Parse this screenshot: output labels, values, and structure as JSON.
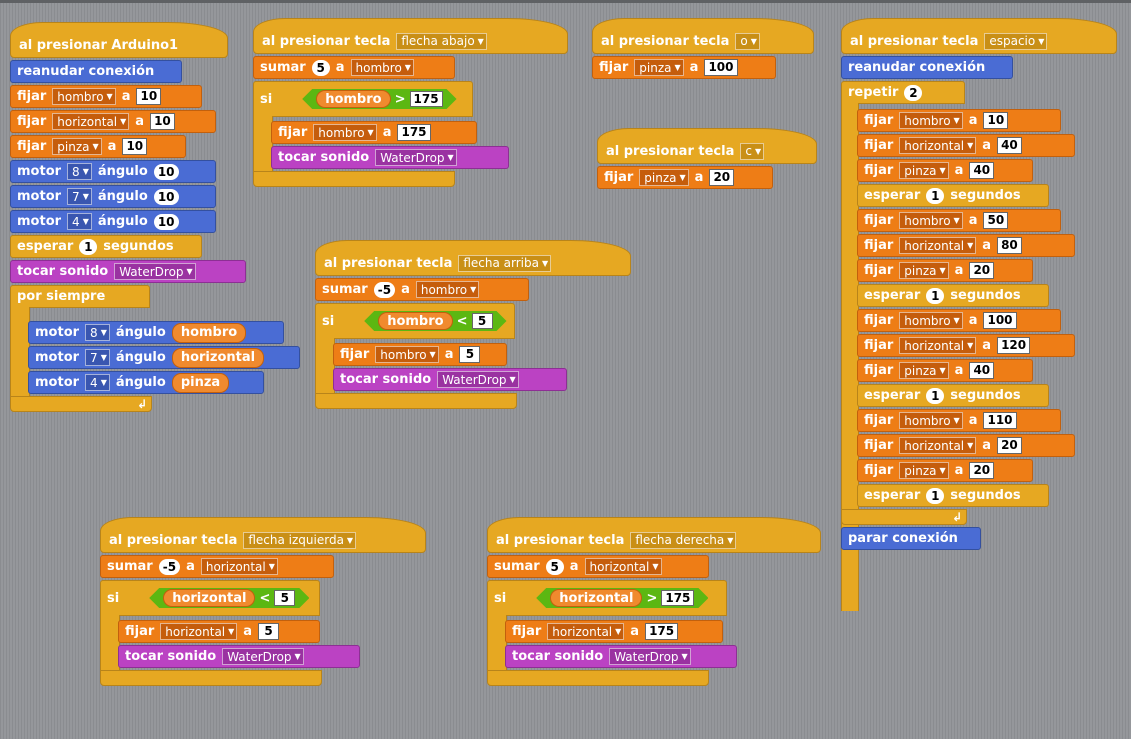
{
  "colors": {
    "control": "#e6a822",
    "variables": "#ee7d16",
    "motion": "#4a6cd4",
    "sound": "#bb42c3",
    "operator": "#5cb712"
  },
  "s1": {
    "hat": "al presionar  Arduino1",
    "resume": "reanudar conexión",
    "set1": {
      "kw": "fijar",
      "var": "hombro",
      "a": "a",
      "val": "10"
    },
    "set2": {
      "kw": "fijar",
      "var": "horizontal",
      "a": "a",
      "val": "10"
    },
    "set3": {
      "kw": "fijar",
      "var": "pinza",
      "a": "a",
      "val": "10"
    },
    "m1": {
      "kw": "motor",
      "port": "8",
      "angle": "ángulo",
      "val": "10"
    },
    "m2": {
      "kw": "motor",
      "port": "7",
      "angle": "ángulo",
      "val": "10"
    },
    "m3": {
      "kw": "motor",
      "port": "4",
      "angle": "ángulo",
      "val": "10"
    },
    "wait": {
      "kw": "esperar",
      "val": "1",
      "unit": "segundos"
    },
    "sound": {
      "kw": "tocar sonido",
      "name": "WaterDrop"
    },
    "forever": "por siempre",
    "fm1": {
      "kw": "motor",
      "port": "8",
      "angle": "ángulo",
      "rep": "hombro"
    },
    "fm2": {
      "kw": "motor",
      "port": "7",
      "angle": "ángulo",
      "rep": "horizontal"
    },
    "fm3": {
      "kw": "motor",
      "port": "4",
      "angle": "ángulo",
      "rep": "pinza"
    }
  },
  "s2": {
    "hat": "al presionar tecla",
    "key": "flecha abajo",
    "change": {
      "kw": "sumar",
      "val": "5",
      "a": "a",
      "var": "hombro"
    },
    "if": "si",
    "cond": {
      "rep": "hombro",
      "op": ">",
      "val": "175"
    },
    "set": {
      "kw": "fijar",
      "var": "hombro",
      "a": "a",
      "val": "175"
    },
    "sound": {
      "kw": "tocar sonido",
      "name": "WaterDrop"
    }
  },
  "s3": {
    "hat": "al presionar tecla",
    "key": "flecha arriba",
    "change": {
      "kw": "sumar",
      "val": "-5",
      "a": "a",
      "var": "hombro"
    },
    "if": "si",
    "cond": {
      "rep": "hombro",
      "op": "<",
      "val": "5"
    },
    "set": {
      "kw": "fijar",
      "var": "hombro",
      "a": "a",
      "val": "5"
    },
    "sound": {
      "kw": "tocar sonido",
      "name": "WaterDrop"
    }
  },
  "s4": {
    "hat": "al presionar tecla",
    "key": "o",
    "set": {
      "kw": "fijar",
      "var": "pinza",
      "a": "a",
      "val": "100"
    }
  },
  "s5": {
    "hat": "al presionar tecla",
    "key": "c",
    "set": {
      "kw": "fijar",
      "var": "pinza",
      "a": "a",
      "val": "20"
    }
  },
  "s6": {
    "hat": "al presionar tecla",
    "key": "espacio",
    "resume": "reanudar conexión",
    "repeat": {
      "kw": "repetir",
      "val": "2"
    },
    "steps": [
      {
        "type": "set",
        "kw": "fijar",
        "var": "hombro",
        "a": "a",
        "val": "10"
      },
      {
        "type": "set",
        "kw": "fijar",
        "var": "horizontal",
        "a": "a",
        "val": "40"
      },
      {
        "type": "set",
        "kw": "fijar",
        "var": "pinza",
        "a": "a",
        "val": "40"
      },
      {
        "type": "wait",
        "kw": "esperar",
        "val": "1",
        "unit": "segundos"
      },
      {
        "type": "set",
        "kw": "fijar",
        "var": "hombro",
        "a": "a",
        "val": "50"
      },
      {
        "type": "set",
        "kw": "fijar",
        "var": "horizontal",
        "a": "a",
        "val": "80"
      },
      {
        "type": "set",
        "kw": "fijar",
        "var": "pinza",
        "a": "a",
        "val": "20"
      },
      {
        "type": "wait",
        "kw": "esperar",
        "val": "1",
        "unit": "segundos"
      },
      {
        "type": "set",
        "kw": "fijar",
        "var": "hombro",
        "a": "a",
        "val": "100"
      },
      {
        "type": "set",
        "kw": "fijar",
        "var": "horizontal",
        "a": "a",
        "val": "120"
      },
      {
        "type": "set",
        "kw": "fijar",
        "var": "pinza",
        "a": "a",
        "val": "40"
      },
      {
        "type": "wait",
        "kw": "esperar",
        "val": "1",
        "unit": "segundos"
      },
      {
        "type": "set",
        "kw": "fijar",
        "var": "hombro",
        "a": "a",
        "val": "110"
      },
      {
        "type": "set",
        "kw": "fijar",
        "var": "horizontal",
        "a": "a",
        "val": "20"
      },
      {
        "type": "set",
        "kw": "fijar",
        "var": "pinza",
        "a": "a",
        "val": "20"
      },
      {
        "type": "wait",
        "kw": "esperar",
        "val": "1",
        "unit": "segundos"
      }
    ],
    "stop": "parar conexión"
  },
  "s7": {
    "hat": "al presionar tecla",
    "key": "flecha izquierda",
    "change": {
      "kw": "sumar",
      "val": "-5",
      "a": "a",
      "var": "horizontal"
    },
    "if": "si",
    "cond": {
      "rep": "horizontal",
      "op": "<",
      "val": "5"
    },
    "set": {
      "kw": "fijar",
      "var": "horizontal",
      "a": "a",
      "val": "5"
    },
    "sound": {
      "kw": "tocar sonido",
      "name": "WaterDrop"
    }
  },
  "s8": {
    "hat": "al presionar tecla",
    "key": "flecha derecha",
    "change": {
      "kw": "sumar",
      "val": "5",
      "a": "a",
      "var": "horizontal"
    },
    "if": "si",
    "cond": {
      "rep": "horizontal",
      "op": ">",
      "val": "175"
    },
    "set": {
      "kw": "fijar",
      "var": "horizontal",
      "a": "a",
      "val": "175"
    },
    "sound": {
      "kw": "tocar sonido",
      "name": "WaterDrop"
    }
  }
}
